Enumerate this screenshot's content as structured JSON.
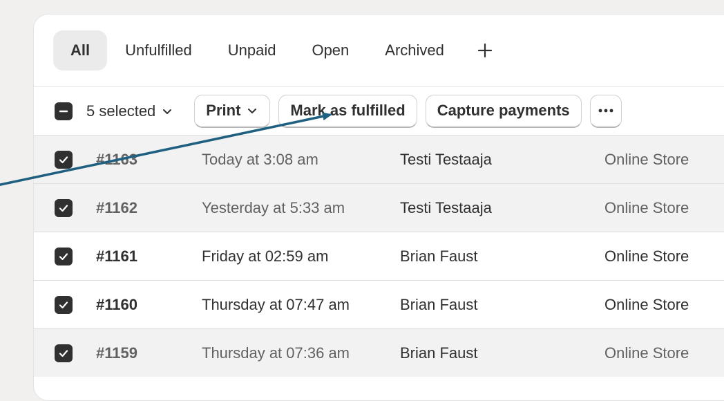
{
  "tabs": [
    {
      "label": "All",
      "active": true
    },
    {
      "label": "Unfulfilled",
      "active": false
    },
    {
      "label": "Unpaid",
      "active": false
    },
    {
      "label": "Open",
      "active": false
    },
    {
      "label": "Archived",
      "active": false
    }
  ],
  "add_tab_icon": "plus-icon",
  "bulk": {
    "selected_label": "5 selected",
    "print_label": "Print",
    "mark_fulfilled_label": "Mark as fulfilled",
    "capture_label": "Capture payments",
    "more_icon": "more-horizontal-icon"
  },
  "orders": [
    {
      "number": "#1163",
      "date": "Today at 3:08 am",
      "customer": "Testi Testaaja",
      "channel": "Online Store"
    },
    {
      "number": "#1162",
      "date": "Yesterday at 5:33 am",
      "customer": "Testi Testaaja",
      "channel": "Online Store"
    },
    {
      "number": "#1161",
      "date": "Friday at 02:59 am",
      "customer": "Brian Faust",
      "channel": "Online Store"
    },
    {
      "number": "#1160",
      "date": "Thursday at 07:47 am",
      "customer": "Brian Faust",
      "channel": "Online Store"
    },
    {
      "number": "#1159",
      "date": "Thursday at 07:36 am",
      "customer": "Brian Faust",
      "channel": "Online Store"
    }
  ],
  "colors": {
    "page_bg": "#f1f0ee",
    "checkbox": "#303030",
    "annotation_arrow": "#1f5f80"
  }
}
